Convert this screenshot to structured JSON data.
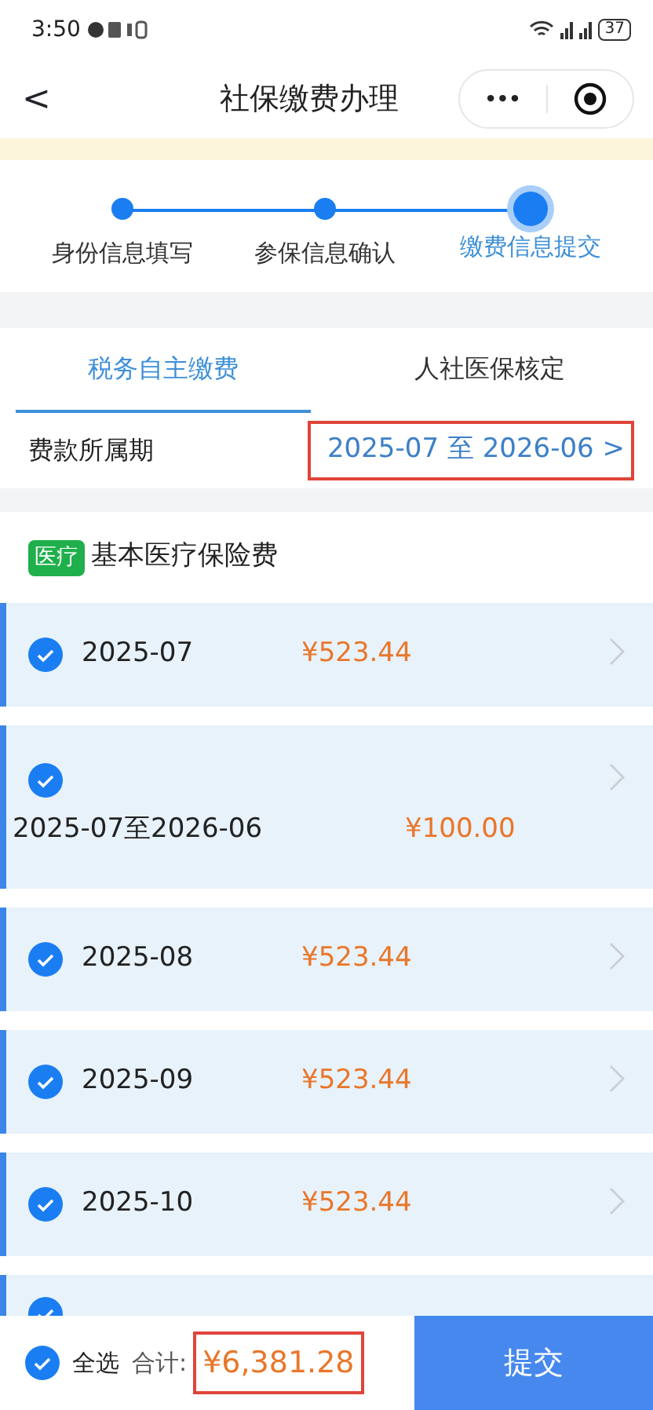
{
  "status_bar": {
    "time": "3:50",
    "battery": "37"
  },
  "nav": {
    "back": "<",
    "title": "社保缴费办理",
    "more": "•••"
  },
  "steps": [
    {
      "label": "身份信息填写",
      "current": false
    },
    {
      "label": "参保信息确认",
      "current": false
    },
    {
      "label": "缴费信息提交",
      "current": true
    }
  ],
  "tabs": [
    {
      "label": "税务自主缴费",
      "selected": true
    },
    {
      "label": "人社医保核定",
      "selected": false
    }
  ],
  "period": {
    "label": "费款所属期",
    "value": "2025-07 至 2026-06",
    "chevron": ">",
    "highlighted": true
  },
  "section": {
    "tag": "医疗",
    "title": "基本医疗保险费"
  },
  "items": [
    {
      "kind": "month",
      "period": "2025-07",
      "amount": "¥523.44",
      "checked": true
    },
    {
      "kind": "wide",
      "period": "2025-07至2026-06",
      "amount": "¥100.00",
      "checked": true
    },
    {
      "kind": "month",
      "period": "2025-08",
      "amount": "¥523.44",
      "checked": true
    },
    {
      "kind": "month",
      "period": "2025-09",
      "amount": "¥523.44",
      "checked": true
    },
    {
      "kind": "month",
      "period": "2025-10",
      "amount": "¥523.44",
      "checked": true
    },
    {
      "kind": "partial",
      "checked": true
    }
  ],
  "footer": {
    "select_all": "全选",
    "select_all_checked": true,
    "total_label": "合计:",
    "total": "¥6,381.28",
    "total_highlighted": true,
    "submit": "提交"
  }
}
